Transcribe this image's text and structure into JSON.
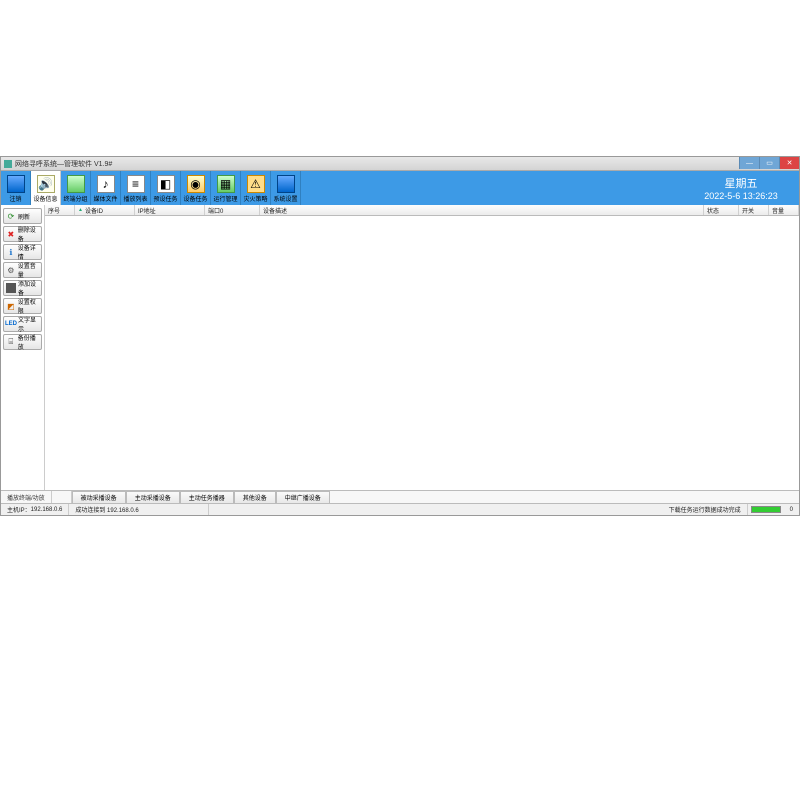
{
  "window": {
    "title": "网络寻呼系统—管理软件  V1.9#"
  },
  "toolbar": {
    "items": [
      {
        "label": "注销"
      },
      {
        "label": "设备信息"
      },
      {
        "label": "终端分组"
      },
      {
        "label": "媒体文件"
      },
      {
        "label": "播放列表"
      },
      {
        "label": "预设任务"
      },
      {
        "label": "设备任务"
      },
      {
        "label": "运行管理"
      },
      {
        "label": "灾火策略"
      },
      {
        "label": "系统设置"
      }
    ]
  },
  "datetime": {
    "weekday": "星期五",
    "line": "2022-5-6  13:26:23"
  },
  "sidebar": {
    "items": [
      {
        "label": "刷新"
      },
      {
        "label": "删除设备"
      },
      {
        "label": "设备详情"
      },
      {
        "label": "设置音量"
      },
      {
        "label": "添加设备"
      },
      {
        "label": "设置权限"
      },
      {
        "label": "文字显示"
      },
      {
        "label": "备份播放"
      }
    ]
  },
  "grid": {
    "columns": {
      "c0": "序号",
      "c1": "设备ID",
      "c2": "IP地址",
      "c3": "端口0",
      "c4": "设备描述",
      "c5": "状态",
      "c6": "开关",
      "c7": "音量"
    }
  },
  "bottom_tabs": {
    "label": "播放终端/功放",
    "tabs": {
      "t0": "被动采播设备",
      "t1": "主动采播设备",
      "t2": "主动任务播器",
      "t3": "其他设备",
      "t4": "中继广播设备"
    }
  },
  "status": {
    "host_label": "主机IP：",
    "host_ip": "192.168.0.6",
    "conn_msg": "成功连接到 192.168.0.6",
    "task_msg": "下载任务运行数据成功完成",
    "progress_value": "0"
  }
}
